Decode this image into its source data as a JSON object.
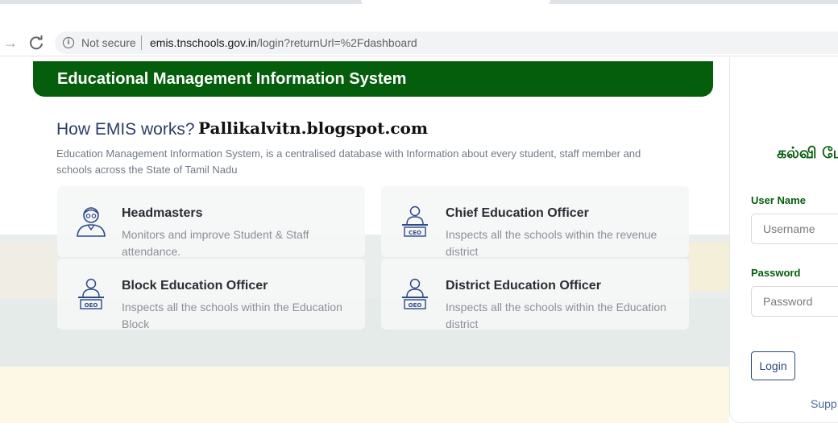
{
  "browser": {
    "not_secure": "Not secure",
    "url_host": "emis.tnschools.gov.in",
    "url_path": "/login?returnUrl=%2Fdashboard"
  },
  "banner": {
    "title": "Educational Management Information System"
  },
  "info": {
    "heading": "How EMIS works?",
    "watermark": "Pallikalvitn.blogspot.com",
    "description": "Education Management Information System, is a centralised database with Information about every student, staff member and schools across the State of Tamil Nadu"
  },
  "roles": [
    {
      "title": "Headmasters",
      "desc": "Monitors and improve Student & Staff attendance."
    },
    {
      "title": "Chief Education Officer",
      "desc": "Inspects all the schools within the revenue district",
      "badge": "CEO"
    },
    {
      "title": "Block Education Officer",
      "desc": "Inspects all the schools within the Education Block",
      "badge": "OEO"
    },
    {
      "title": "District Education Officer",
      "desc": "Inspects all the schools within the Education district",
      "badge": "OEO"
    }
  ],
  "login": {
    "tamil_title": "கல்வி மே",
    "username_label": "User Name",
    "username_placeholder": "Username",
    "password_label": "Password",
    "password_placeholder": "Password",
    "login_label": "Login",
    "support_text": "Supp"
  },
  "colors": {
    "brand_green": "#055e0b",
    "navy": "#2c3e68"
  }
}
